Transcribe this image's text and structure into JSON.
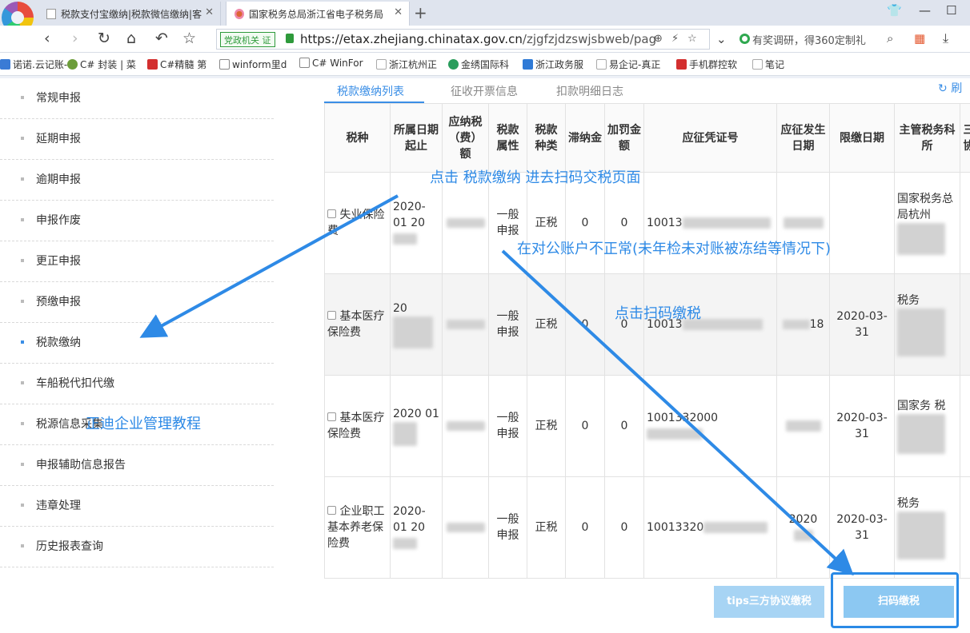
{
  "browser": {
    "tabs": [
      {
        "title": "税款支付宝缴纳|税款微信缴纳|客"
      },
      {
        "title": "国家税务总局浙江省电子税务局"
      }
    ],
    "address": {
      "badge": "党政机关 证",
      "url_host": "https://etax.zhejiang.chinatax.gov.cn",
      "url_path": "/zjgfzjdzswjsbweb/pag"
    },
    "search_text": "有奖调研，得360定制礼",
    "bookmarks": [
      "诺诺.云记账-",
      "C# 封装 | 菜",
      "C#精髓 第",
      "winform里d",
      "C# WinFor",
      "浙江杭州正",
      "金绣国际科",
      "浙江政务服",
      "易企记-真正",
      "手机群控软",
      "笔记"
    ]
  },
  "sidebar": {
    "items": [
      {
        "label": "常规申报"
      },
      {
        "label": "延期申报"
      },
      {
        "label": "逾期申报"
      },
      {
        "label": "申报作废"
      },
      {
        "label": "更正申报"
      },
      {
        "label": "预缴申报"
      },
      {
        "label": "税款缴纳"
      },
      {
        "label": "车船税代扣代缴"
      },
      {
        "label": "税源信息采集"
      },
      {
        "label": "申报辅助信息报告"
      },
      {
        "label": "违章处理"
      },
      {
        "label": "历史报表查询"
      }
    ]
  },
  "content": {
    "tabs": [
      {
        "label": "税款缴纳列表"
      },
      {
        "label": "征收开票信息"
      },
      {
        "label": "扣款明细日志"
      }
    ],
    "refresh": "刷",
    "table": {
      "headers": [
        "税种",
        "所属日期起止",
        "应纳税（费）额",
        "税款属性",
        "税款种类",
        "滞纳金",
        "加罚金额",
        "应征凭证号",
        "应征发生日期",
        "限缴日期",
        "主管税务科所",
        "三方协议"
      ],
      "rows": [
        {
          "tax": "失业保险费",
          "period": "2020-01 20",
          "attr": "一般申报",
          "kind": "正税",
          "late": "0",
          "fine": "0",
          "voucher": "10013",
          "occur": "",
          "due": "",
          "office": "国家税务总局杭州",
          "agreement": "√"
        },
        {
          "tax": "基本医疗保险费",
          "period": "20",
          "attr": "一般申报",
          "kind": "正税",
          "late": "0",
          "fine": "0",
          "voucher": "10013",
          "occur": "18",
          "due": "2020-03-31",
          "office": "税务",
          "agreement": "√"
        },
        {
          "tax": "基本医疗保险费",
          "period": "2020 01",
          "attr": "一般申报",
          "kind": "正税",
          "late": "0",
          "fine": "0",
          "voucher": "1001332000",
          "occur": "",
          "due": "2020-03-31",
          "office": "国家务 税",
          "agreement": "√"
        },
        {
          "tax": "企业职工基本养老保险费",
          "period": "2020- 01 20",
          "attr": "一般申报",
          "kind": "正税",
          "late": "0",
          "fine": "0",
          "voucher": "10013320",
          "occur": "2020",
          "due": "2020-03-31",
          "office": "税务",
          "agreement": "√"
        }
      ]
    },
    "buttons": {
      "tips": "tips三方协议缴税",
      "scan": "扫码缴税"
    }
  },
  "annotations": {
    "a1": "点击   税款缴纳    进去扫码交税页面",
    "a2": "在对公账户不正常(未年检未对账被冻结等情况下)",
    "a3": "点击扫码缴税",
    "a4": "正迪企业管理教程"
  },
  "colors": {
    "accent": "#3a8ee6",
    "annotation": "#2e8ae6"
  }
}
